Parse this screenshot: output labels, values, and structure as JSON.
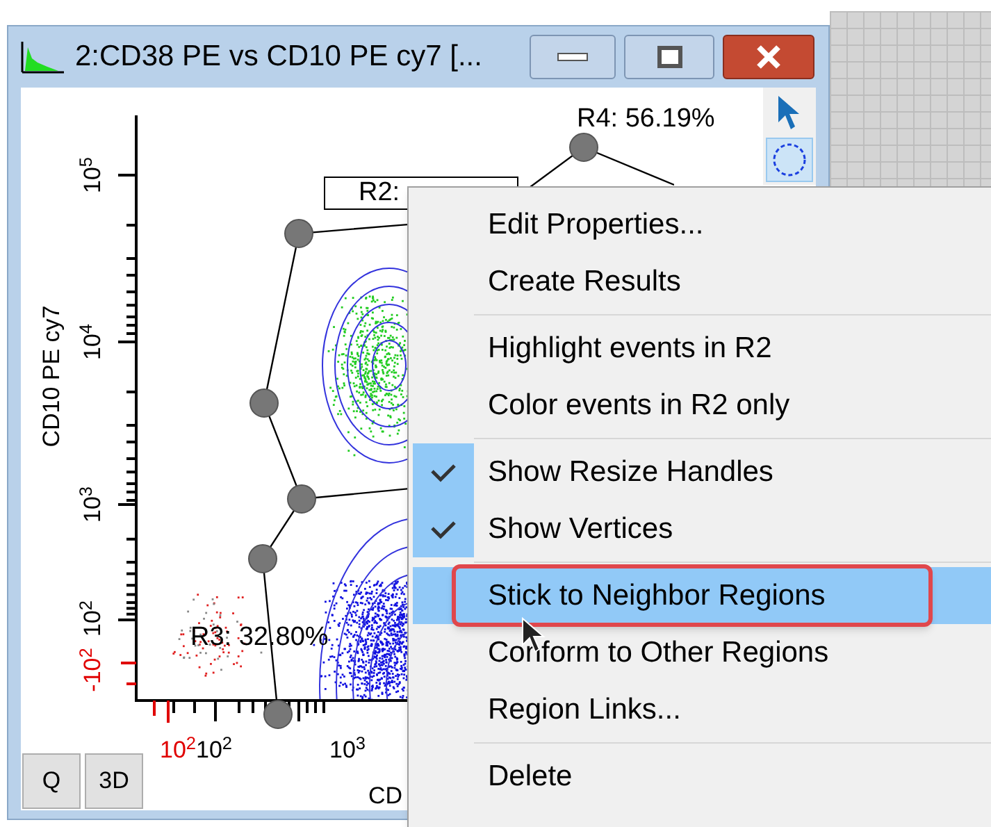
{
  "window": {
    "title": "2:CD38 PE vs CD10 PE cy7 [..."
  },
  "plot": {
    "y_axis_title": "CD10 PE cy7",
    "x_axis_title": "CD",
    "y_ticks": [
      {
        "label": "10$^{5}$",
        "negative": false
      },
      {
        "label": "10$^{4}$",
        "negative": false
      },
      {
        "label": "10$^{3}$",
        "negative": false
      },
      {
        "label": "10$^{2}$",
        "negative": false
      },
      {
        "label": "-10$^{2}$",
        "negative": true
      }
    ],
    "x_ticks": [
      {
        "label": "10$^{2}$",
        "negative": true
      },
      {
        "label": "10$^{2}$",
        "negative": false
      },
      {
        "label": "10$^{3}$",
        "negative": false
      }
    ],
    "regions": [
      {
        "label": "R4: 56.19%",
        "boxed": false
      },
      {
        "label": "R2:",
        "boxed": true
      },
      {
        "label": "R3: 32.80%",
        "boxed": false
      }
    ]
  },
  "view_buttons": [
    "Q",
    "3D"
  ],
  "tools": [
    {
      "kind": "pointer",
      "selected": false
    },
    {
      "kind": "ellipse",
      "selected": true
    }
  ],
  "context_menu": {
    "groups": [
      [
        {
          "label": "Edit Properties...",
          "checked": false,
          "highlighted": false,
          "outlined": false
        },
        {
          "label": "Create Results",
          "checked": false,
          "highlighted": false,
          "outlined": false
        }
      ],
      [
        {
          "label": "Highlight events in R2",
          "checked": false,
          "highlighted": false,
          "outlined": false
        },
        {
          "label": "Color events in R2 only",
          "checked": false,
          "highlighted": false,
          "outlined": false
        }
      ],
      [
        {
          "label": "Show Resize Handles",
          "checked": true,
          "highlighted": false,
          "outlined": false
        },
        {
          "label": "Show Vertices",
          "checked": true,
          "highlighted": false,
          "outlined": false
        }
      ],
      [
        {
          "label": "Stick to Neighbor Regions",
          "checked": false,
          "highlighted": true,
          "outlined": true
        },
        {
          "label": "Conform to Other Regions",
          "checked": false,
          "highlighted": false,
          "outlined": false
        },
        {
          "label": "Region Links...",
          "checked": false,
          "highlighted": false,
          "outlined": false
        }
      ],
      [
        {
          "label": "Delete",
          "checked": false,
          "highlighted": false,
          "outlined": false
        }
      ]
    ]
  }
}
